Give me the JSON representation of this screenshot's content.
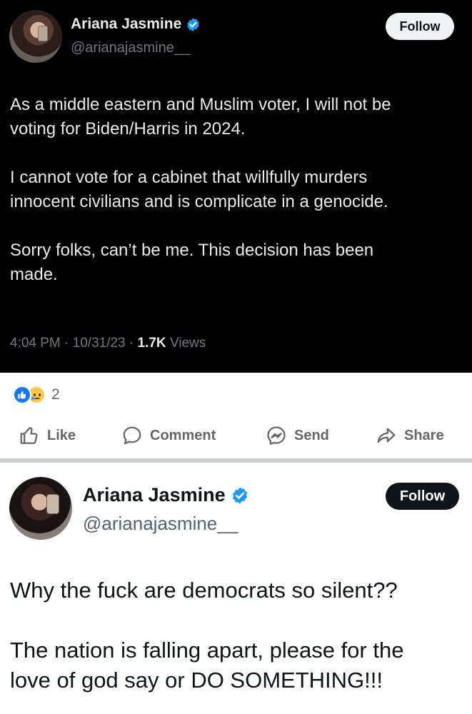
{
  "top_tweet": {
    "display_name": "Ariana Jasmine",
    "handle": "@arianajasmine__",
    "follow_label": "Follow",
    "paragraphs": [
      "As a middle eastern and Muslim voter, I will not be\nvoting for Biden/Harris in 2024.",
      "I cannot vote for a cabinet that willfully murders\ninnocent civilians and is complicate in a genocide.",
      "Sorry folks, can’t be me. This decision has been\nmade."
    ],
    "time": "4:04 PM",
    "date": "10/31/23",
    "views_count": "1.7K",
    "views_label": "Views",
    "separator": "·",
    "colors": {
      "background": "#000000",
      "text": "#e7e9ea",
      "muted": "#71767b"
    }
  },
  "facebook_bar": {
    "reactions": [
      "like-reaction-icon",
      "sad-reaction-icon"
    ],
    "reaction_count": "2",
    "actions": [
      {
        "label": "Like",
        "icon": "thumbs-up-icon"
      },
      {
        "label": "Comment",
        "icon": "speech-bubble-icon"
      },
      {
        "label": "Send",
        "icon": "messenger-icon"
      },
      {
        "label": "Share",
        "icon": "share-arrow-icon"
      }
    ],
    "colors": {
      "action_text": "#65676b",
      "like_blue": "#1877f2"
    }
  },
  "bottom_tweet": {
    "display_name": "Ariana Jasmine",
    "handle": "@arianajasmine__",
    "follow_label": "Follow",
    "paragraphs": [
      "Why the fuck are democrats so silent??",
      "The nation is falling apart, please for the\nlove of god say or DO SOMETHING!!!"
    ],
    "colors": {
      "background": "#ffffff",
      "text": "#0f1419",
      "muted": "#536471",
      "verified": "#1d9bf0"
    }
  }
}
